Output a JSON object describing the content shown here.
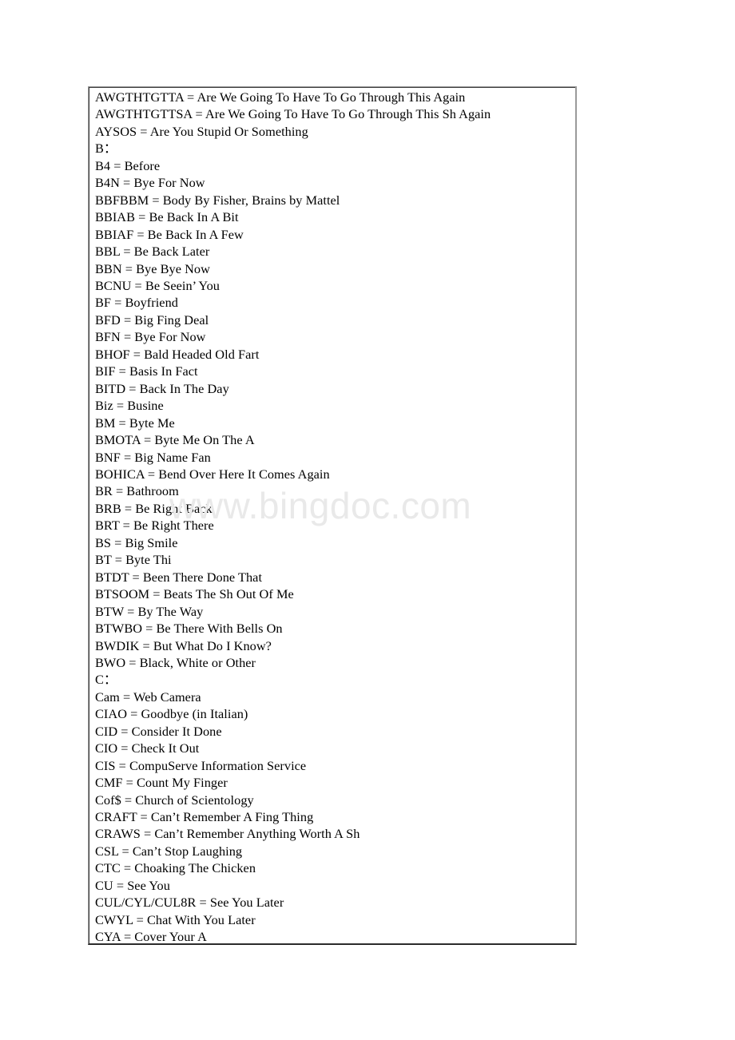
{
  "page": {
    "background_color": "#ffffff",
    "watermark": "www.bingdoc.com",
    "watermark_color": "#e9e9e9"
  },
  "glossary": {
    "border_color": "#3a3a3a",
    "entries": [
      {
        "text": "AWGTHTGTTA = Are We Going To Have To Go Through This Again",
        "type": "definition"
      },
      {
        "text": "AWGTHTGTTSA = Are We Going To Have To Go Through This Sh Again",
        "type": "definition"
      },
      {
        "text": "AYSOS = Are You Stupid Or Something",
        "type": "definition"
      },
      {
        "text": "B：",
        "type": "section"
      },
      {
        "text": "B4 = Before",
        "type": "definition"
      },
      {
        "text": "B4N = Bye For Now",
        "type": "definition"
      },
      {
        "text": "BBFBBM = Body By Fisher, Brains by Mattel",
        "type": "definition"
      },
      {
        "text": "BBIAB = Be Back In A Bit",
        "type": "definition"
      },
      {
        "text": "BBIAF = Be Back In A Few",
        "type": "definition"
      },
      {
        "text": "BBL = Be Back Later",
        "type": "definition"
      },
      {
        "text": "BBN = Bye Bye Now",
        "type": "definition"
      },
      {
        "text": "BCNU = Be Seein’ You",
        "type": "definition"
      },
      {
        "text": "BF = Boyfriend",
        "type": "definition"
      },
      {
        "text": "BFD = Big Fing Deal",
        "type": "definition"
      },
      {
        "text": "BFN = Bye For Now",
        "type": "definition"
      },
      {
        "text": "BHOF = Bald Headed Old Fart",
        "type": "definition"
      },
      {
        "text": "BIF = Basis In Fact",
        "type": "definition"
      },
      {
        "text": "BITD = Back In The Day",
        "type": "definition"
      },
      {
        "text": "Biz = Busine",
        "type": "definition"
      },
      {
        "text": "BM = Byte Me",
        "type": "definition"
      },
      {
        "text": "BMOTA = Byte Me On The A",
        "type": "definition"
      },
      {
        "text": "BNF = Big Name Fan",
        "type": "definition"
      },
      {
        "text": "BOHICA = Bend Over Here It Comes Again",
        "type": "definition"
      },
      {
        "text": "BR = Bathroom",
        "type": "definition"
      },
      {
        "text": "BRB = Be Right Back",
        "type": "definition"
      },
      {
        "text": "BRT = Be Right There",
        "type": "definition"
      },
      {
        "text": "BS = Big Smile",
        "type": "definition"
      },
      {
        "text": "BT = Byte Thi",
        "type": "definition"
      },
      {
        "text": "BTDT = Been There Done That",
        "type": "definition"
      },
      {
        "text": "BTSOOM = Beats The Sh Out Of Me",
        "type": "definition"
      },
      {
        "text": "BTW = By The Way",
        "type": "definition"
      },
      {
        "text": "BTWBO = Be There With Bells On",
        "type": "definition"
      },
      {
        "text": "BWDIK = But What Do I Know?",
        "type": "definition"
      },
      {
        "text": "BWO = Black, White or Other",
        "type": "definition"
      },
      {
        "text": "C：",
        "type": "section"
      },
      {
        "text": "Cam = Web Camera",
        "type": "definition"
      },
      {
        "text": "CIAO = Goodbye (in Italian)",
        "type": "definition"
      },
      {
        "text": "CID = Consider It Done",
        "type": "definition"
      },
      {
        "text": "CIO = Check It Out",
        "type": "definition"
      },
      {
        "text": "CIS = CompuServe Information Service",
        "type": "definition"
      },
      {
        "text": "CMF = Count My Finger",
        "type": "definition"
      },
      {
        "text": "Cof$ = Church of Scientology",
        "type": "definition"
      },
      {
        "text": "CRAFT = Can’t Remember A Fing Thing",
        "type": "definition"
      },
      {
        "text": "CRAWS = Can’t Remember Anything Worth A Sh",
        "type": "definition"
      },
      {
        "text": "CSL = Can’t Stop Laughing",
        "type": "definition"
      },
      {
        "text": "CTC = Choaking The Chicken",
        "type": "definition"
      },
      {
        "text": "CU = See You",
        "type": "definition"
      },
      {
        "text": "CUL/CYL/CUL8R = See You Later",
        "type": "definition"
      },
      {
        "text": "CWYL = Chat With You Later",
        "type": "definition"
      },
      {
        "text": "CYA = Cover Your A",
        "type": "definition"
      }
    ]
  }
}
